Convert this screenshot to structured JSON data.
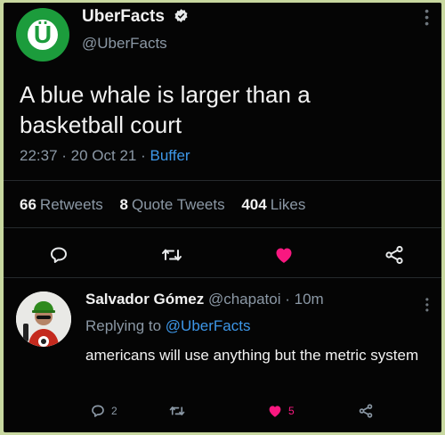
{
  "tweet": {
    "display_name": "UberFacts",
    "handle": "@UberFacts",
    "avatar_letter": "Ü",
    "text": "A blue whale is larger than a basketball court",
    "time": "22:37",
    "date": "20 Oct 21",
    "source": "Buffer",
    "stats": {
      "retweets_count": "66",
      "retweets_label": "Retweets",
      "quotes_count": "8",
      "quotes_label": "Quote Tweets",
      "likes_count": "404",
      "likes_label": "Likes"
    }
  },
  "reply": {
    "display_name": "Salvador Gómez",
    "handle": "@chapatoi",
    "age": "10m",
    "replying_prefix": "Replying to",
    "replying_to": "@UberFacts",
    "text": "americans will use anything but the metric system",
    "reply_count": "2",
    "retweet_count": "",
    "like_count": "5"
  },
  "icons": {
    "reply": "reply-icon",
    "retweet": "retweet-icon",
    "like": "heart-icon",
    "share": "share-icon",
    "more": "more-icon",
    "verified": "verified-badge-icon"
  },
  "colors": {
    "background": "#050505",
    "text": "#f2f2f2",
    "muted": "#8b98a5",
    "link": "#3d97e8",
    "like": "#f91880",
    "brand": "#1c9c3c"
  }
}
